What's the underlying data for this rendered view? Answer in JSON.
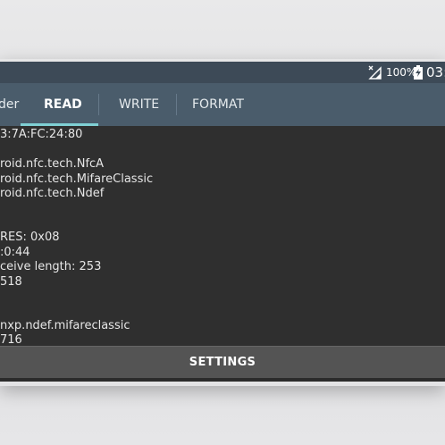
{
  "status_bar": {
    "battery_percent": "100%",
    "time": "03:",
    "icons": [
      "signal-no-sim-icon",
      "battery-charging-icon"
    ]
  },
  "tabs": [
    {
      "label": "der"
    },
    {
      "label": "READ",
      "active": true
    },
    {
      "label": "WRITE"
    },
    {
      "label": "FORMAT"
    }
  ],
  "content_lines": [
    "3:7A:FC:24:80",
    "",
    "roid.nfc.tech.NfcA",
    "roid.nfc.tech.MifareClassic",
    "roid.nfc.tech.Ndef",
    "",
    "",
    "RES: 0x08",
    ":0:44",
    "ceive length: 253",
    "518",
    "",
    "",
    "nxp.ndef.mifareclassic",
    "716"
  ],
  "settings": {
    "label": "SETTINGS"
  },
  "colors": {
    "status_bar": "#3d4a57",
    "toolbar": "#4a5c6b",
    "tab_indicator": "#7fd0d4",
    "content_bg": "#2f2f2f",
    "settings_bg": "#545454"
  }
}
